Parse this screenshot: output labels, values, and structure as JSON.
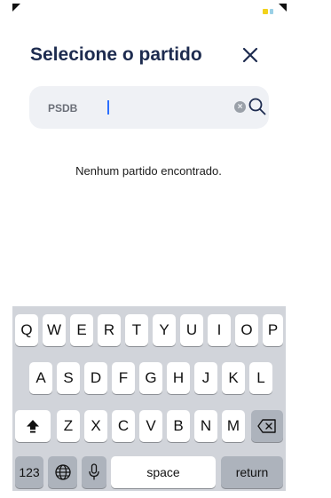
{
  "header": {
    "title": "Selecione o partido"
  },
  "search": {
    "value": "PSDB",
    "placeholder": ""
  },
  "results": {
    "empty_message": "Nenhum partido encontrado."
  },
  "keyboard": {
    "row1": [
      "Q",
      "W",
      "E",
      "R",
      "T",
      "Y",
      "U",
      "I",
      "O",
      "P"
    ],
    "row2": [
      "A",
      "S",
      "D",
      "F",
      "G",
      "H",
      "J",
      "K",
      "L"
    ],
    "row3": [
      "Z",
      "X",
      "C",
      "V",
      "B",
      "N",
      "M"
    ],
    "numbers_label": "123",
    "space_label": "space",
    "return_label": "return"
  },
  "icons": [
    "close-icon",
    "search-icon",
    "clear-icon",
    "shift-icon",
    "backspace-icon",
    "globe-icon",
    "microphone-icon"
  ],
  "colors": {
    "title": "#1d2b4f",
    "search_bg": "#eff1f5",
    "caret": "#2b6fff",
    "keyboard_bg": "#d1d4da"
  }
}
